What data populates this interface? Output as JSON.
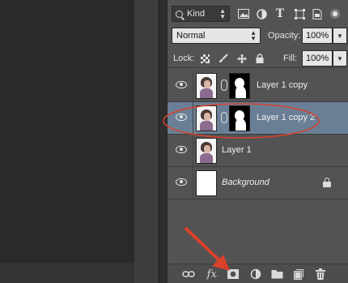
{
  "filter": {
    "kind_label": "Kind"
  },
  "blend": {
    "mode": "Normal",
    "opacity_label": "Opacity:",
    "opacity_value": "100%",
    "lock_label": "Lock:",
    "fill_label": "Fill:",
    "fill_value": "100%"
  },
  "layers": [
    {
      "name": "Layer 1 copy",
      "visible": true,
      "selected": false,
      "has_mask": true
    },
    {
      "name": "Layer 1 copy 2",
      "visible": true,
      "selected": true,
      "has_mask": true
    },
    {
      "name": "Layer 1",
      "visible": true,
      "selected": false,
      "has_mask": false
    },
    {
      "name": "Background",
      "visible": true,
      "selected": false,
      "locked": true
    }
  ],
  "footer": {
    "fx_label": "fx"
  },
  "colors": {
    "panel": "#535353",
    "selected_row": "#6a7f96",
    "annotation_red": "#d9412b"
  }
}
